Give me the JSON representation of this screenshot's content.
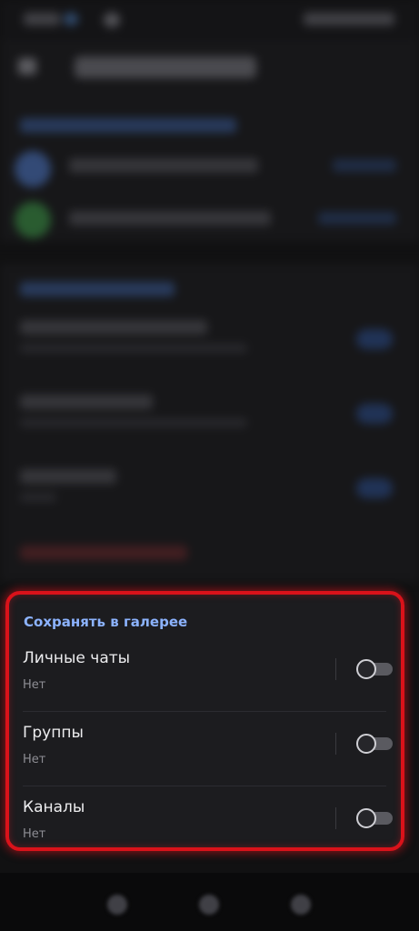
{
  "gallery_section": {
    "header": "Сохранять в галерее",
    "rows": [
      {
        "title": "Личные чаты",
        "value": "Нет",
        "enabled": false
      },
      {
        "title": "Группы",
        "value": "Нет",
        "enabled": false
      },
      {
        "title": "Каналы",
        "value": "Нет",
        "enabled": false
      }
    ]
  },
  "colors": {
    "accent": "#8cb3ff",
    "highlight_frame": "#d9121a",
    "background": "#111112",
    "surface": "#1c1c1f"
  },
  "icons": {
    "nav_back": "back-arrow-icon",
    "nav_home": "home-icon",
    "nav_recents": "recents-icon"
  }
}
